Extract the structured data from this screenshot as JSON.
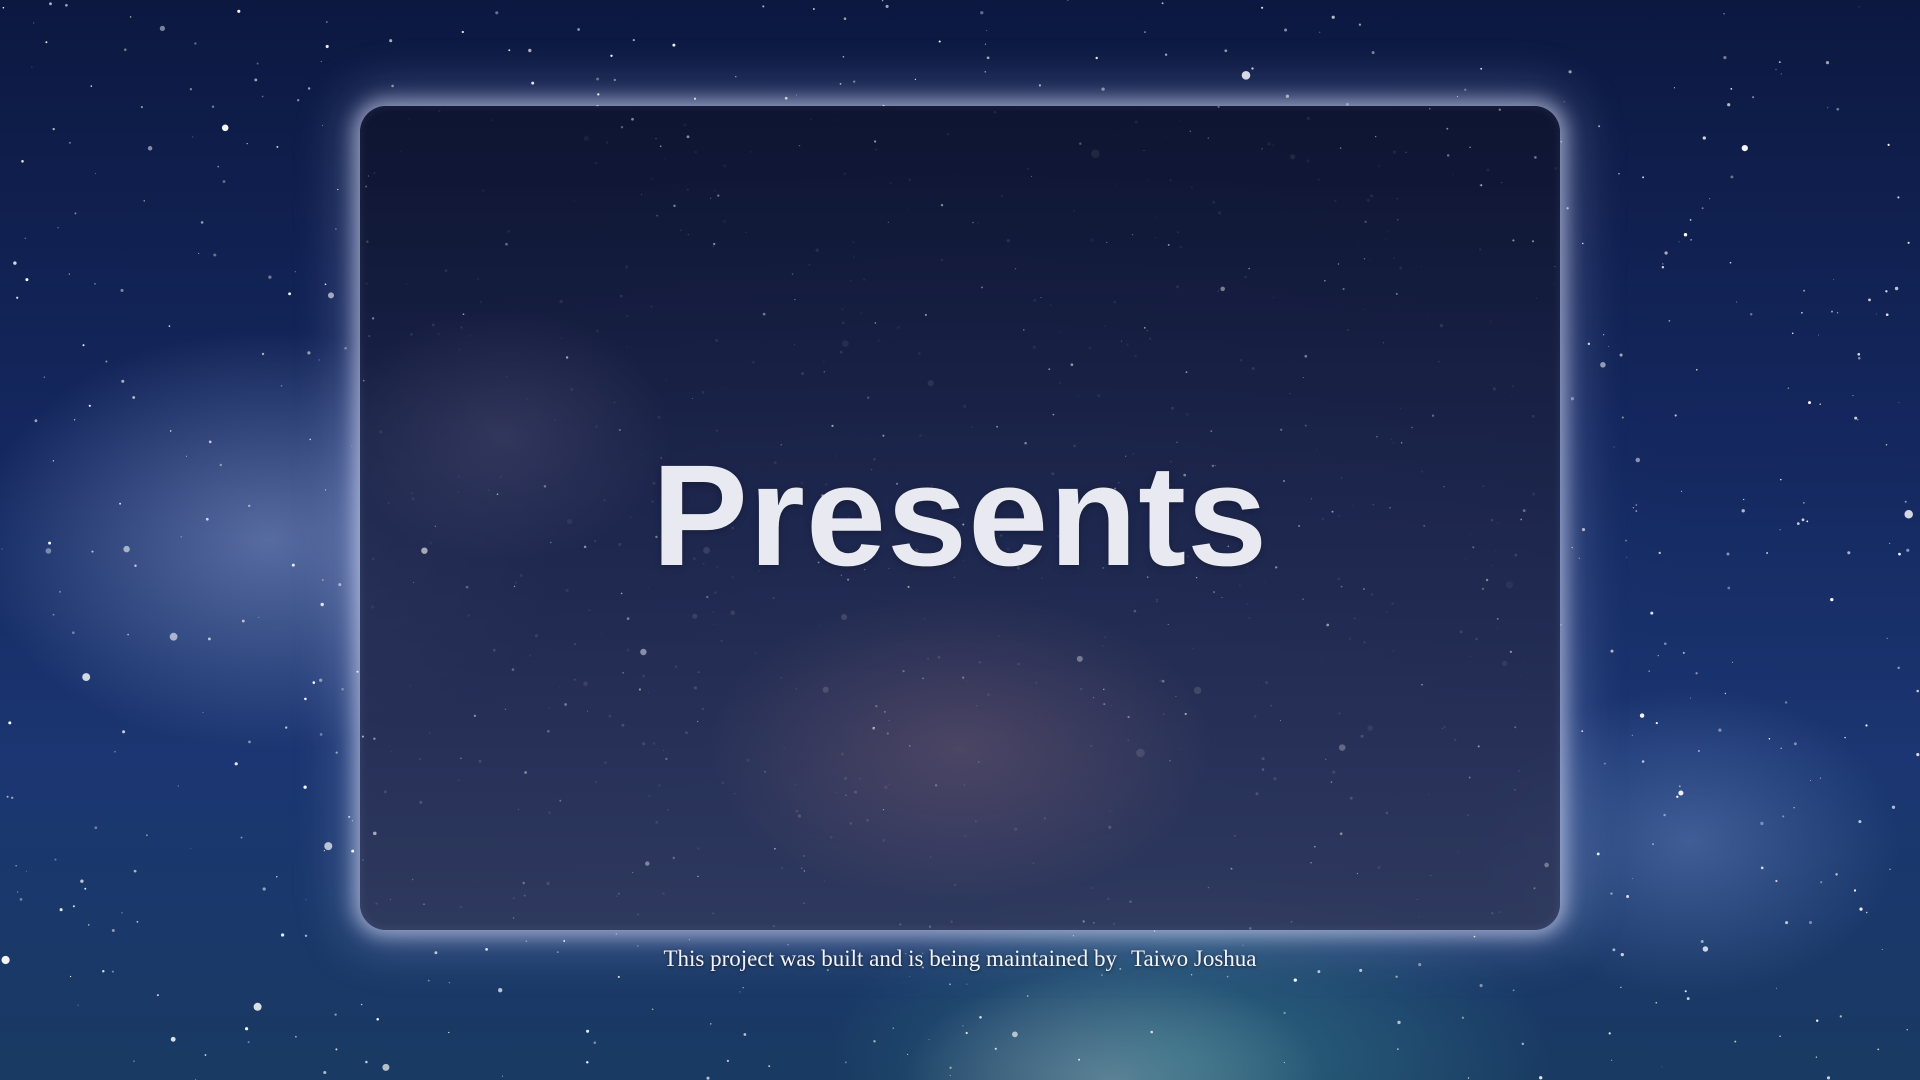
{
  "hero": {
    "title": "Presents"
  },
  "footer": {
    "credit_text": "This project was built and is being maintained by",
    "author_name": "Taiwo Joshua"
  },
  "theme": {
    "background": "#14275e",
    "title_color": "#e8e9f1",
    "footer_text_color": "#f2f3f8",
    "card_glow": "#e1e6ff"
  }
}
